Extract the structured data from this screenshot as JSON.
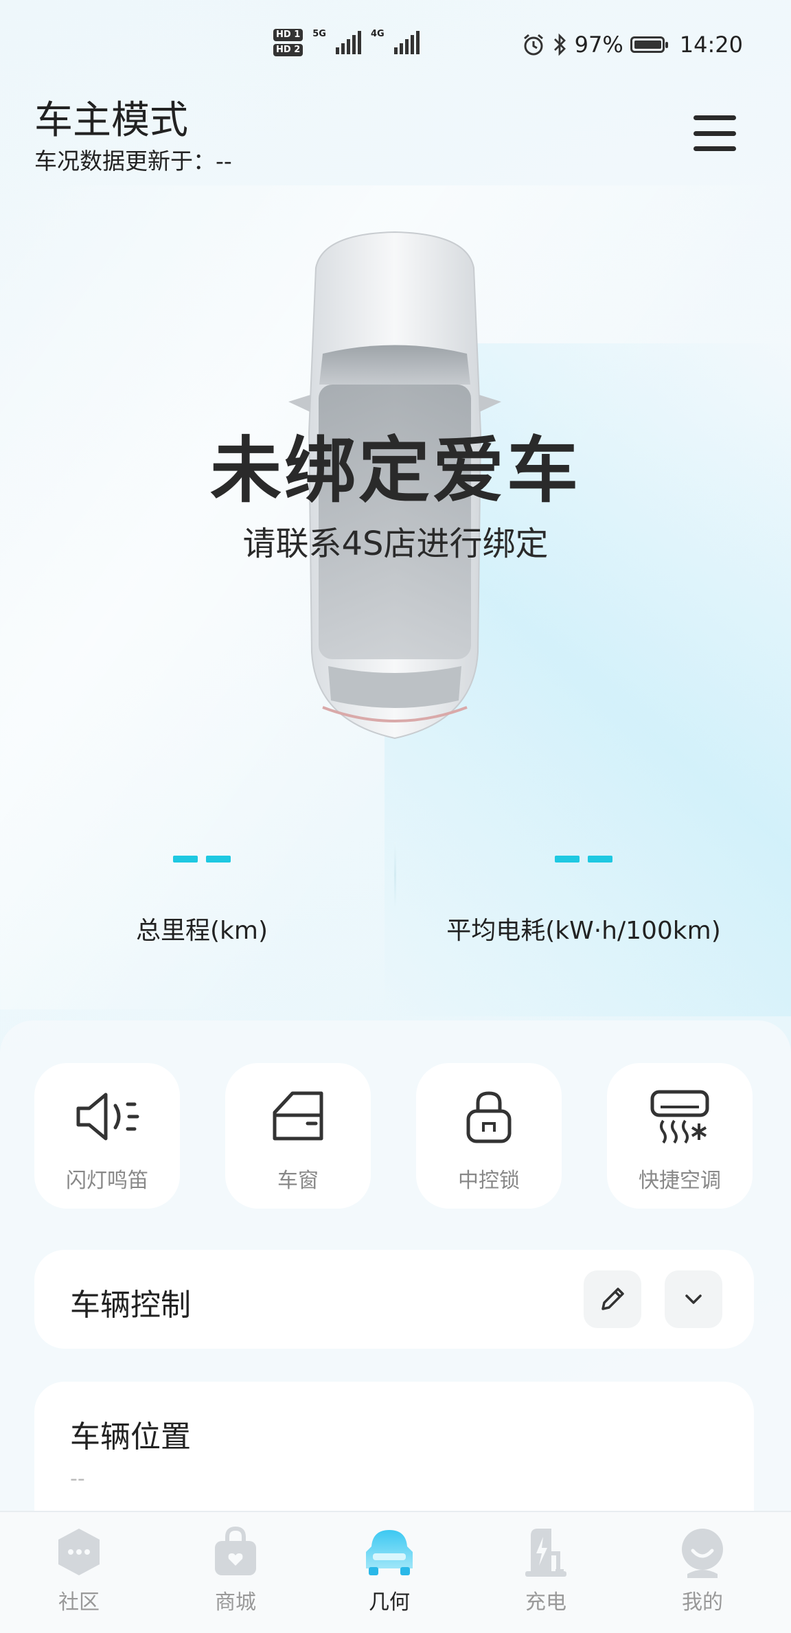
{
  "status_bar": {
    "hd1": "HD 1",
    "hd2": "HD 2",
    "net1": "5G",
    "net2": "4G",
    "battery": "97%",
    "time": "14:20"
  },
  "header": {
    "title": "车主模式",
    "subtitle": "车况数据更新于：--",
    "menu_icon": "hamburger-menu-icon"
  },
  "car_status": {
    "headline": "未绑定爱车",
    "hint": "请联系4S店进行绑定"
  },
  "stats": [
    {
      "value": "--",
      "label": "总里程(km)"
    },
    {
      "value": "--",
      "label": "平均电耗(kW·h/100km)"
    }
  ],
  "quick_actions": [
    {
      "label": "闪灯鸣笛",
      "icon": "horn-icon"
    },
    {
      "label": "车窗",
      "icon": "window-icon"
    },
    {
      "label": "中控锁",
      "icon": "lock-icon"
    },
    {
      "label": "快捷空调",
      "icon": "air-conditioner-icon"
    }
  ],
  "vehicle_control": {
    "title": "车辆控制",
    "edit_icon": "pencil-icon",
    "expand_icon": "chevron-down-icon"
  },
  "vehicle_location": {
    "title": "车辆位置",
    "value": "--"
  },
  "bottom_nav": [
    {
      "label": "社区",
      "icon": "community-icon",
      "active": false
    },
    {
      "label": "商城",
      "icon": "shop-bag-icon",
      "active": false
    },
    {
      "label": "几何",
      "icon": "car-icon",
      "active": true
    },
    {
      "label": "充电",
      "icon": "charging-icon",
      "active": false
    },
    {
      "label": "我的",
      "icon": "profile-icon",
      "active": false
    }
  ],
  "colors": {
    "accent": "#1ec8e1",
    "active_nav": "#2ab8e8"
  }
}
